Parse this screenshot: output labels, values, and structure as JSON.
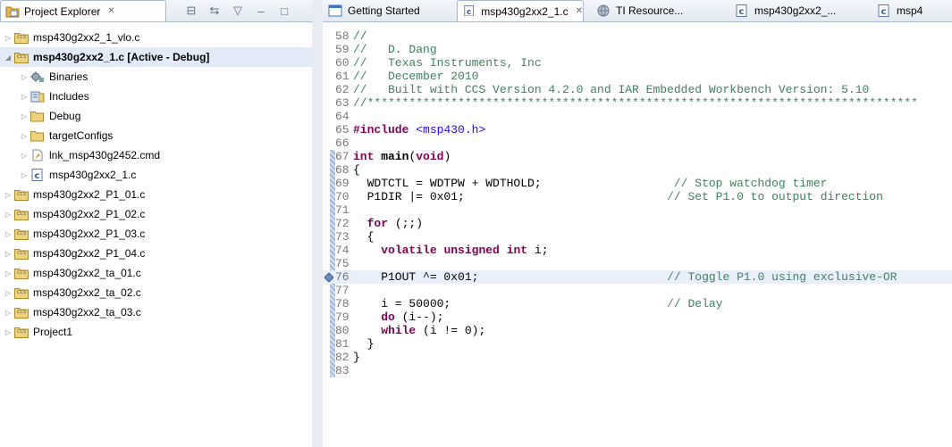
{
  "explorer": {
    "title": "Project Explorer",
    "close_glyph": "✕",
    "tools": [
      "collapse-all-icon",
      "link-editor-icon",
      "view-menu-icon",
      "minimize-icon",
      "maximize-icon"
    ],
    "tool_glyphs": [
      "⊟",
      "⇆",
      "▽",
      "–",
      "□"
    ],
    "items": [
      {
        "label": "msp430g2xx2_1_vlo.c",
        "icon": "ccs-project-icon",
        "level": 0,
        "twisty": "▷",
        "active": false
      },
      {
        "label": "msp430g2xx2_1.c  [Active - Debug]",
        "icon": "ccs-project-icon",
        "level": 0,
        "twisty": "◢",
        "active": true
      },
      {
        "label": "Binaries",
        "icon": "binaries-icon",
        "level": 1,
        "twisty": "▷",
        "active": false
      },
      {
        "label": "Includes",
        "icon": "includes-icon",
        "level": 1,
        "twisty": "▷",
        "active": false
      },
      {
        "label": "Debug",
        "icon": "folder-icon",
        "level": 1,
        "twisty": "▷",
        "active": false
      },
      {
        "label": "targetConfigs",
        "icon": "folder-icon",
        "level": 1,
        "twisty": "▷",
        "active": false
      },
      {
        "label": "lnk_msp430g2452.cmd",
        "icon": "linker-file-icon",
        "level": 1,
        "twisty": "▷",
        "active": false
      },
      {
        "label": "msp430g2xx2_1.c",
        "icon": "c-file-icon",
        "level": 1,
        "twisty": "▷",
        "active": false
      },
      {
        "label": "msp430g2xx2_P1_01.c",
        "icon": "ccs-project-icon",
        "level": 0,
        "twisty": "▷",
        "active": false
      },
      {
        "label": "msp430g2xx2_P1_02.c",
        "icon": "ccs-project-icon",
        "level": 0,
        "twisty": "▷",
        "active": false
      },
      {
        "label": "msp430g2xx2_P1_03.c",
        "icon": "ccs-project-icon",
        "level": 0,
        "twisty": "▷",
        "active": false
      },
      {
        "label": "msp430g2xx2_P1_04.c",
        "icon": "ccs-project-icon",
        "level": 0,
        "twisty": "▷",
        "active": false
      },
      {
        "label": "msp430g2xx2_ta_01.c",
        "icon": "ccs-project-icon",
        "level": 0,
        "twisty": "▷",
        "active": false
      },
      {
        "label": "msp430g2xx2_ta_02.c",
        "icon": "ccs-project-icon",
        "level": 0,
        "twisty": "▷",
        "active": false
      },
      {
        "label": "msp430g2xx2_ta_03.c",
        "icon": "ccs-project-icon",
        "level": 0,
        "twisty": "▷",
        "active": false
      },
      {
        "label": "Project1",
        "icon": "ccs-project-icon",
        "level": 0,
        "twisty": "▷",
        "active": false
      }
    ]
  },
  "editor": {
    "tabs": [
      {
        "label": "Getting Started",
        "icon": "getting-started-icon",
        "selected": false
      },
      {
        "label": "msp430g2xx2_1.c",
        "icon": "c-file-icon",
        "selected": true,
        "close": "✕"
      },
      {
        "label": "TI Resource...",
        "icon": "ti-resource-icon",
        "selected": false
      },
      {
        "label": "msp430g2xx2_...",
        "icon": "c-file-icon",
        "selected": false
      },
      {
        "label": "msp4",
        "icon": "c-file-icon",
        "selected": false
      }
    ],
    "lines": [
      {
        "n": "58",
        "tokens": [
          [
            "cm",
            "//"
          ]
        ]
      },
      {
        "n": "59",
        "tokens": [
          [
            "cm",
            "//   D. Dang"
          ]
        ]
      },
      {
        "n": "60",
        "tokens": [
          [
            "cm",
            "//   Texas Instruments, Inc"
          ]
        ]
      },
      {
        "n": "61",
        "tokens": [
          [
            "cm",
            "//   December 2010"
          ]
        ]
      },
      {
        "n": "62",
        "tokens": [
          [
            "cm",
            "//   Built with CCS Version 4.2.0 and IAR Embedded Workbench Version: 5.10"
          ]
        ]
      },
      {
        "n": "63",
        "tokens": [
          [
            "cm",
            "//*******************************************************************************"
          ]
        ]
      },
      {
        "n": "64",
        "tokens": []
      },
      {
        "n": "65",
        "tokens": [
          [
            "pp",
            "#include"
          ],
          [
            "tx",
            " "
          ],
          [
            "str",
            "<msp430.h>"
          ]
        ]
      },
      {
        "n": "66",
        "tokens": []
      },
      {
        "n": "67",
        "tokens": [
          [
            "kw",
            "int"
          ],
          [
            "tx",
            " "
          ],
          [
            "b",
            "main"
          ],
          [
            "tx",
            "("
          ],
          [
            "kw",
            "void"
          ],
          [
            "tx",
            ")"
          ]
        ]
      },
      {
        "n": "68",
        "tokens": [
          [
            "tx",
            "{"
          ]
        ]
      },
      {
        "n": "69",
        "tokens": [
          [
            "tx",
            "  WDTCTL = WDTPW + WDTHOLD;                   "
          ],
          [
            "cm",
            "// Stop watchdog timer"
          ]
        ]
      },
      {
        "n": "70",
        "tokens": [
          [
            "tx",
            "  P1DIR |= 0x01;                             "
          ],
          [
            "cm",
            "// Set P1.0 to output direction"
          ]
        ]
      },
      {
        "n": "71",
        "tokens": []
      },
      {
        "n": "72",
        "tokens": [
          [
            "tx",
            "  "
          ],
          [
            "kw",
            "for"
          ],
          [
            "tx",
            " (;;)"
          ]
        ]
      },
      {
        "n": "73",
        "tokens": [
          [
            "tx",
            "  {"
          ]
        ]
      },
      {
        "n": "74",
        "tokens": [
          [
            "tx",
            "    "
          ],
          [
            "kw",
            "volatile"
          ],
          [
            "tx",
            " "
          ],
          [
            "kw",
            "unsigned"
          ],
          [
            "tx",
            " "
          ],
          [
            "kw",
            "int"
          ],
          [
            "tx",
            " i;"
          ]
        ]
      },
      {
        "n": "75",
        "tokens": []
      },
      {
        "n": "76",
        "tokens": [
          [
            "tx",
            "    P1OUT ^= 0x01;                           "
          ],
          [
            "cm",
            "// Toggle P1.0 using exclusive-OR"
          ]
        ],
        "highlight": true,
        "breakpoint": true
      },
      {
        "n": "77",
        "tokens": []
      },
      {
        "n": "78",
        "tokens": [
          [
            "tx",
            "    i = 50000;                               "
          ],
          [
            "cm",
            "// Delay"
          ]
        ]
      },
      {
        "n": "79",
        "tokens": [
          [
            "tx",
            "    "
          ],
          [
            "kw",
            "do"
          ],
          [
            "tx",
            " (i--);"
          ]
        ]
      },
      {
        "n": "80",
        "tokens": [
          [
            "tx",
            "    "
          ],
          [
            "kw",
            "while"
          ],
          [
            "tx",
            " (i != 0);"
          ]
        ]
      },
      {
        "n": "81",
        "tokens": [
          [
            "tx",
            "  }"
          ]
        ]
      },
      {
        "n": "82",
        "tokens": [
          [
            "tx",
            "}"
          ]
        ]
      },
      {
        "n": "83",
        "tokens": []
      }
    ]
  },
  "colors": {
    "keyword": "#7f0055",
    "comment": "#3f7f5f",
    "string": "#2a00ff",
    "line_number": "#787878",
    "current_line": "#e8f0fb",
    "selection": "#e3ebf8"
  }
}
